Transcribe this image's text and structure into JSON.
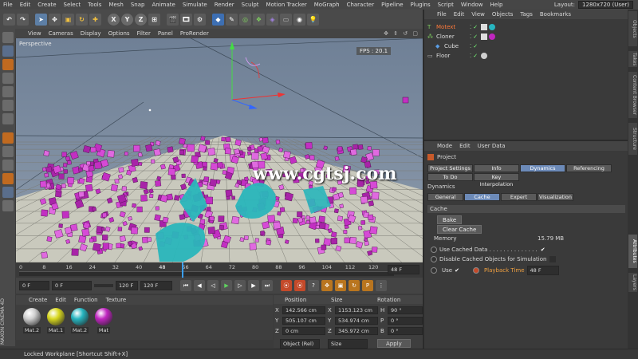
{
  "menu": [
    "File",
    "Edit",
    "Create",
    "Select",
    "Tools",
    "Mesh",
    "Snap",
    "Animate",
    "Simulate",
    "Render",
    "Sculpt",
    "Motion Tracker",
    "MoGraph",
    "Character",
    "Pipeline",
    "Plugins",
    "Script",
    "Window",
    "Help"
  ],
  "layout_label": "Layout:",
  "layout_value": "1280x720 (User)",
  "axis_buttons": [
    "X",
    "Y",
    "Z"
  ],
  "viewport": {
    "menu": [
      "View",
      "Cameras",
      "Display",
      "Options",
      "Filter",
      "Panel",
      "ProRender"
    ],
    "camera": "Perspective",
    "fps": "FPS : 20.1",
    "watermark": "www.cgtsj.com"
  },
  "timeline": {
    "ticks": [
      "0",
      "8",
      "16",
      "24",
      "32",
      "40",
      "48",
      "56",
      "64",
      "72",
      "80",
      "88",
      "96",
      "104",
      "112",
      "120"
    ],
    "current_frame_label": "48",
    "end_field": "48 F"
  },
  "playbar": {
    "start": "0 F",
    "min": "0 F",
    "max": "120 F",
    "end": "120 F"
  },
  "materials": {
    "menu": [
      "Create",
      "Edit",
      "Function",
      "Texture"
    ],
    "items": [
      {
        "name": "Mat.2",
        "color": "#cfcfcf"
      },
      {
        "name": "Mat.1",
        "color": "#d8d820"
      },
      {
        "name": "Mat.2",
        "color": "#27b5c0"
      },
      {
        "name": "Mat",
        "color": "#c026c0"
      }
    ]
  },
  "coordinates": {
    "headers": [
      "Position",
      "Size",
      "Rotation"
    ],
    "rows": [
      {
        "axis": "X",
        "pos": "142.566 cm",
        "size": "1153.123 cm",
        "rot_axis": "H",
        "rot": "90 °"
      },
      {
        "axis": "Y",
        "pos": "505.107 cm",
        "size": "534.974 cm",
        "rot_axis": "P",
        "rot": "0 °"
      },
      {
        "axis": "Z",
        "pos": "0 cm",
        "size": "345.972 cm",
        "rot_axis": "B",
        "rot": "0 °"
      }
    ],
    "mode": "Object (Rel)",
    "size_mode": "Size",
    "apply": "Apply"
  },
  "status": "Locked Workplane [Shortcut Shift+X]",
  "objects": {
    "menu": [
      "File",
      "Edit",
      "View",
      "Objects",
      "Tags",
      "Bookmarks"
    ],
    "items": [
      {
        "name": "Motext",
        "color": "#ff7a3a"
      },
      {
        "name": "Cloner",
        "color": "#dddddd"
      },
      {
        "name": "Cube",
        "color": "#dddddd"
      },
      {
        "name": "Floor",
        "color": "#dddddd"
      }
    ]
  },
  "attributes": {
    "menu": [
      "Mode",
      "Edit",
      "User Data"
    ],
    "object": "Project",
    "tabs_row1": [
      "Project Settings",
      "Info",
      "Dynamics",
      "Referencing"
    ],
    "tabs_row2": [
      "To Do",
      "Key Interpolation"
    ],
    "section": "Dynamics",
    "subtabs": [
      "General",
      "Cache",
      "Expert",
      "Visualization"
    ],
    "cache_section": "Cache",
    "bake": "Bake",
    "clear_cache": "Clear Cache",
    "memory_label": "Memory",
    "memory_value": "15.79 MB",
    "use_cached": "Use Cached Data . . . . . . . . . . . . . .",
    "disable_cached": "Disable Cached Objects for Simulation",
    "use_label": "Use",
    "playback_label": "Playback Time",
    "playback_value": "48 F"
  },
  "side_tabs": [
    "Objects",
    "Takes",
    "Content Browser",
    "Structure",
    "Attributes",
    "Layers"
  ],
  "brand": "MAXON CINEMA 4D"
}
